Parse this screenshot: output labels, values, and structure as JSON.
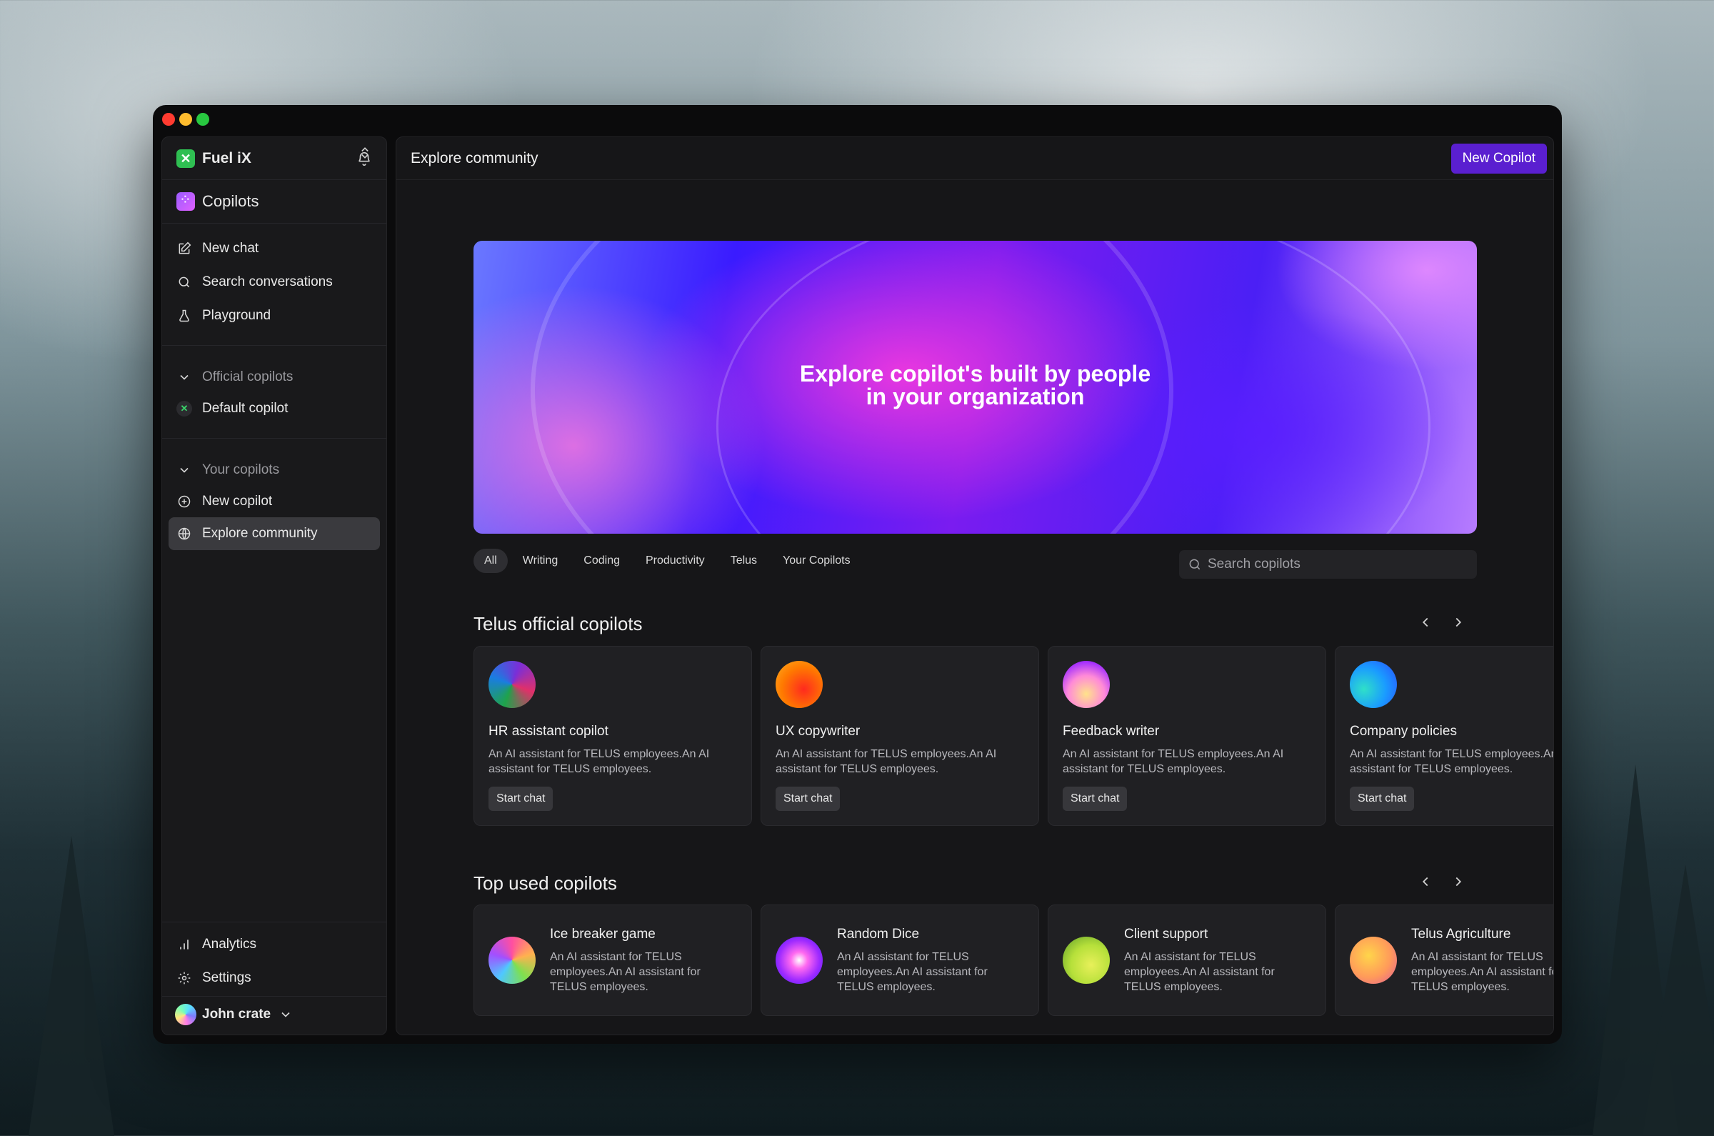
{
  "app": {
    "brand": "Fuel iX",
    "workspace": "Copilots"
  },
  "sidebar": {
    "top_items": [
      {
        "label": "New chat",
        "icon": "edit-icon"
      },
      {
        "label": "Search conversations",
        "icon": "search-icon"
      },
      {
        "label": "Playground",
        "icon": "flask-icon"
      }
    ],
    "official_section": "Official copilots",
    "official_items": [
      {
        "label": "Default copilot",
        "icon": "copilot-logo-icon"
      }
    ],
    "your_section": "Your copilots",
    "your_items": [
      {
        "label": "New copilot",
        "icon": "plus-circle-icon"
      },
      {
        "label": "Explore community",
        "icon": "globe-icon",
        "active": true
      }
    ],
    "bottom_items": [
      {
        "label": "Analytics",
        "icon": "bar-chart-icon"
      },
      {
        "label": "Settings",
        "icon": "gear-icon"
      }
    ],
    "user": "John crate"
  },
  "header": {
    "title": "Explore community",
    "new_button": "New Copilot"
  },
  "hero": {
    "line1": "Explore copilot's built by people",
    "line2": "in your organization"
  },
  "filters": {
    "tabs": [
      "All",
      "Writing",
      "Coding",
      "Productivity",
      "Telus",
      "Your Copilots"
    ],
    "selected": "All",
    "search_placeholder": "Search copilots"
  },
  "official": {
    "title": "Telus official copilots",
    "cards": [
      {
        "name": "HR assistant copilot",
        "desc": "An AI assistant for TELUS employees.An AI assistant for TELUS employees.",
        "button": "Start chat"
      },
      {
        "name": "UX copywriter",
        "desc": "An AI assistant for TELUS employees.An AI assistant for TELUS employees.",
        "button": "Start chat"
      },
      {
        "name": "Feedback writer",
        "desc": "An AI assistant for TELUS employees.An AI assistant for TELUS employees.",
        "button": "Start chat"
      },
      {
        "name": "Company policies",
        "desc": "An AI assistant for TELUS employees.An AI assistant for TELUS employees.",
        "button": "Start chat"
      }
    ]
  },
  "top_used": {
    "title": "Top used copilots",
    "cards": [
      {
        "name": "Ice breaker game",
        "desc": "An AI assistant for TELUS employees.An AI assistant for TELUS employees."
      },
      {
        "name": "Random Dice",
        "desc": "An AI assistant for TELUS employees.An AI assistant for TELUS employees."
      },
      {
        "name": "Client support",
        "desc": "An AI assistant for TELUS employees.An AI assistant for TELUS employees."
      },
      {
        "name": "Telus Agriculture",
        "desc": "An AI assistant for TELUS employees.An AI assistant for TELUS employees."
      }
    ]
  },
  "colors": {
    "accent": "#5a1fd0",
    "surface": "#19191b",
    "card": "#202023"
  }
}
